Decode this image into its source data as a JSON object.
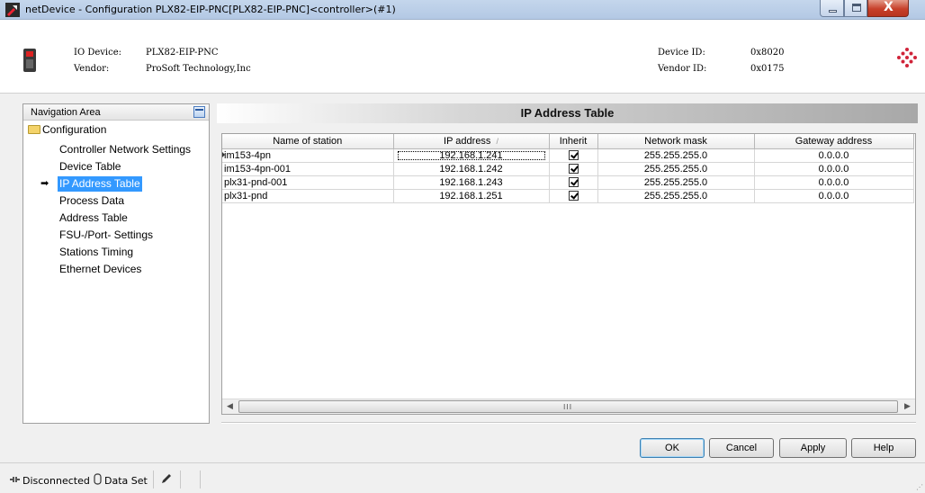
{
  "window": {
    "title": "netDevice - Configuration PLX82-EIP-PNC[PLX82-EIP-PNC]<controller>(#1)",
    "controls": {
      "minimize": "minimize",
      "maximize": "maximize",
      "close": "X"
    }
  },
  "device_info": {
    "io_device_label": "IO Device:",
    "io_device_value": "PLX82-EIP-PNC",
    "vendor_label": "Vendor:",
    "vendor_value": "ProSoft Technology,Inc",
    "device_id_label": "Device ID:",
    "device_id_value": "0x8020",
    "vendor_id_label": "Vendor ID:",
    "vendor_id_value": "0x0175"
  },
  "navigation": {
    "header": "Navigation Area",
    "root": "Configuration",
    "items": [
      {
        "label": "Controller Network Settings",
        "selected": false
      },
      {
        "label": "Device Table",
        "selected": false
      },
      {
        "label": "IP Address Table",
        "selected": true
      },
      {
        "label": "Process Data",
        "selected": false
      },
      {
        "label": "Address Table",
        "selected": false
      },
      {
        "label": "FSU-/Port- Settings",
        "selected": false
      },
      {
        "label": "Stations Timing",
        "selected": false
      },
      {
        "label": "Ethernet Devices",
        "selected": false
      }
    ]
  },
  "content": {
    "title": "IP Address Table",
    "columns": [
      "Name of station",
      "IP address",
      "Inherit",
      "Network mask",
      "Gateway address"
    ],
    "sort_indicator": "/",
    "rows": [
      {
        "name": "im153-4pn",
        "ip": "192.168.1.241",
        "inherit": true,
        "mask": "255.255.255.0",
        "gateway": "0.0.0.0"
      },
      {
        "name": "im153-4pn-001",
        "ip": "192.168.1.242",
        "inherit": true,
        "mask": "255.255.255.0",
        "gateway": "0.0.0.0"
      },
      {
        "name": "plx31-pnd-001",
        "ip": "192.168.1.243",
        "inherit": true,
        "mask": "255.255.255.0",
        "gateway": "0.0.0.0"
      },
      {
        "name": "plx31-pnd",
        "ip": "192.168.1.251",
        "inherit": true,
        "mask": "255.255.255.0",
        "gateway": "0.0.0.0"
      }
    ],
    "scrollbar": {
      "left_arrow": "◀",
      "right_arrow": "▶",
      "grip": "III"
    }
  },
  "buttons": {
    "ok": "OK",
    "cancel": "Cancel",
    "apply": "Apply",
    "help": "Help"
  },
  "statusbar": {
    "connection": "Disconnected",
    "dataset": "Data Set"
  },
  "colors": {
    "selection": "#3399ff",
    "title_bar": "#c4d6ec",
    "close_button": "#c7402a"
  }
}
